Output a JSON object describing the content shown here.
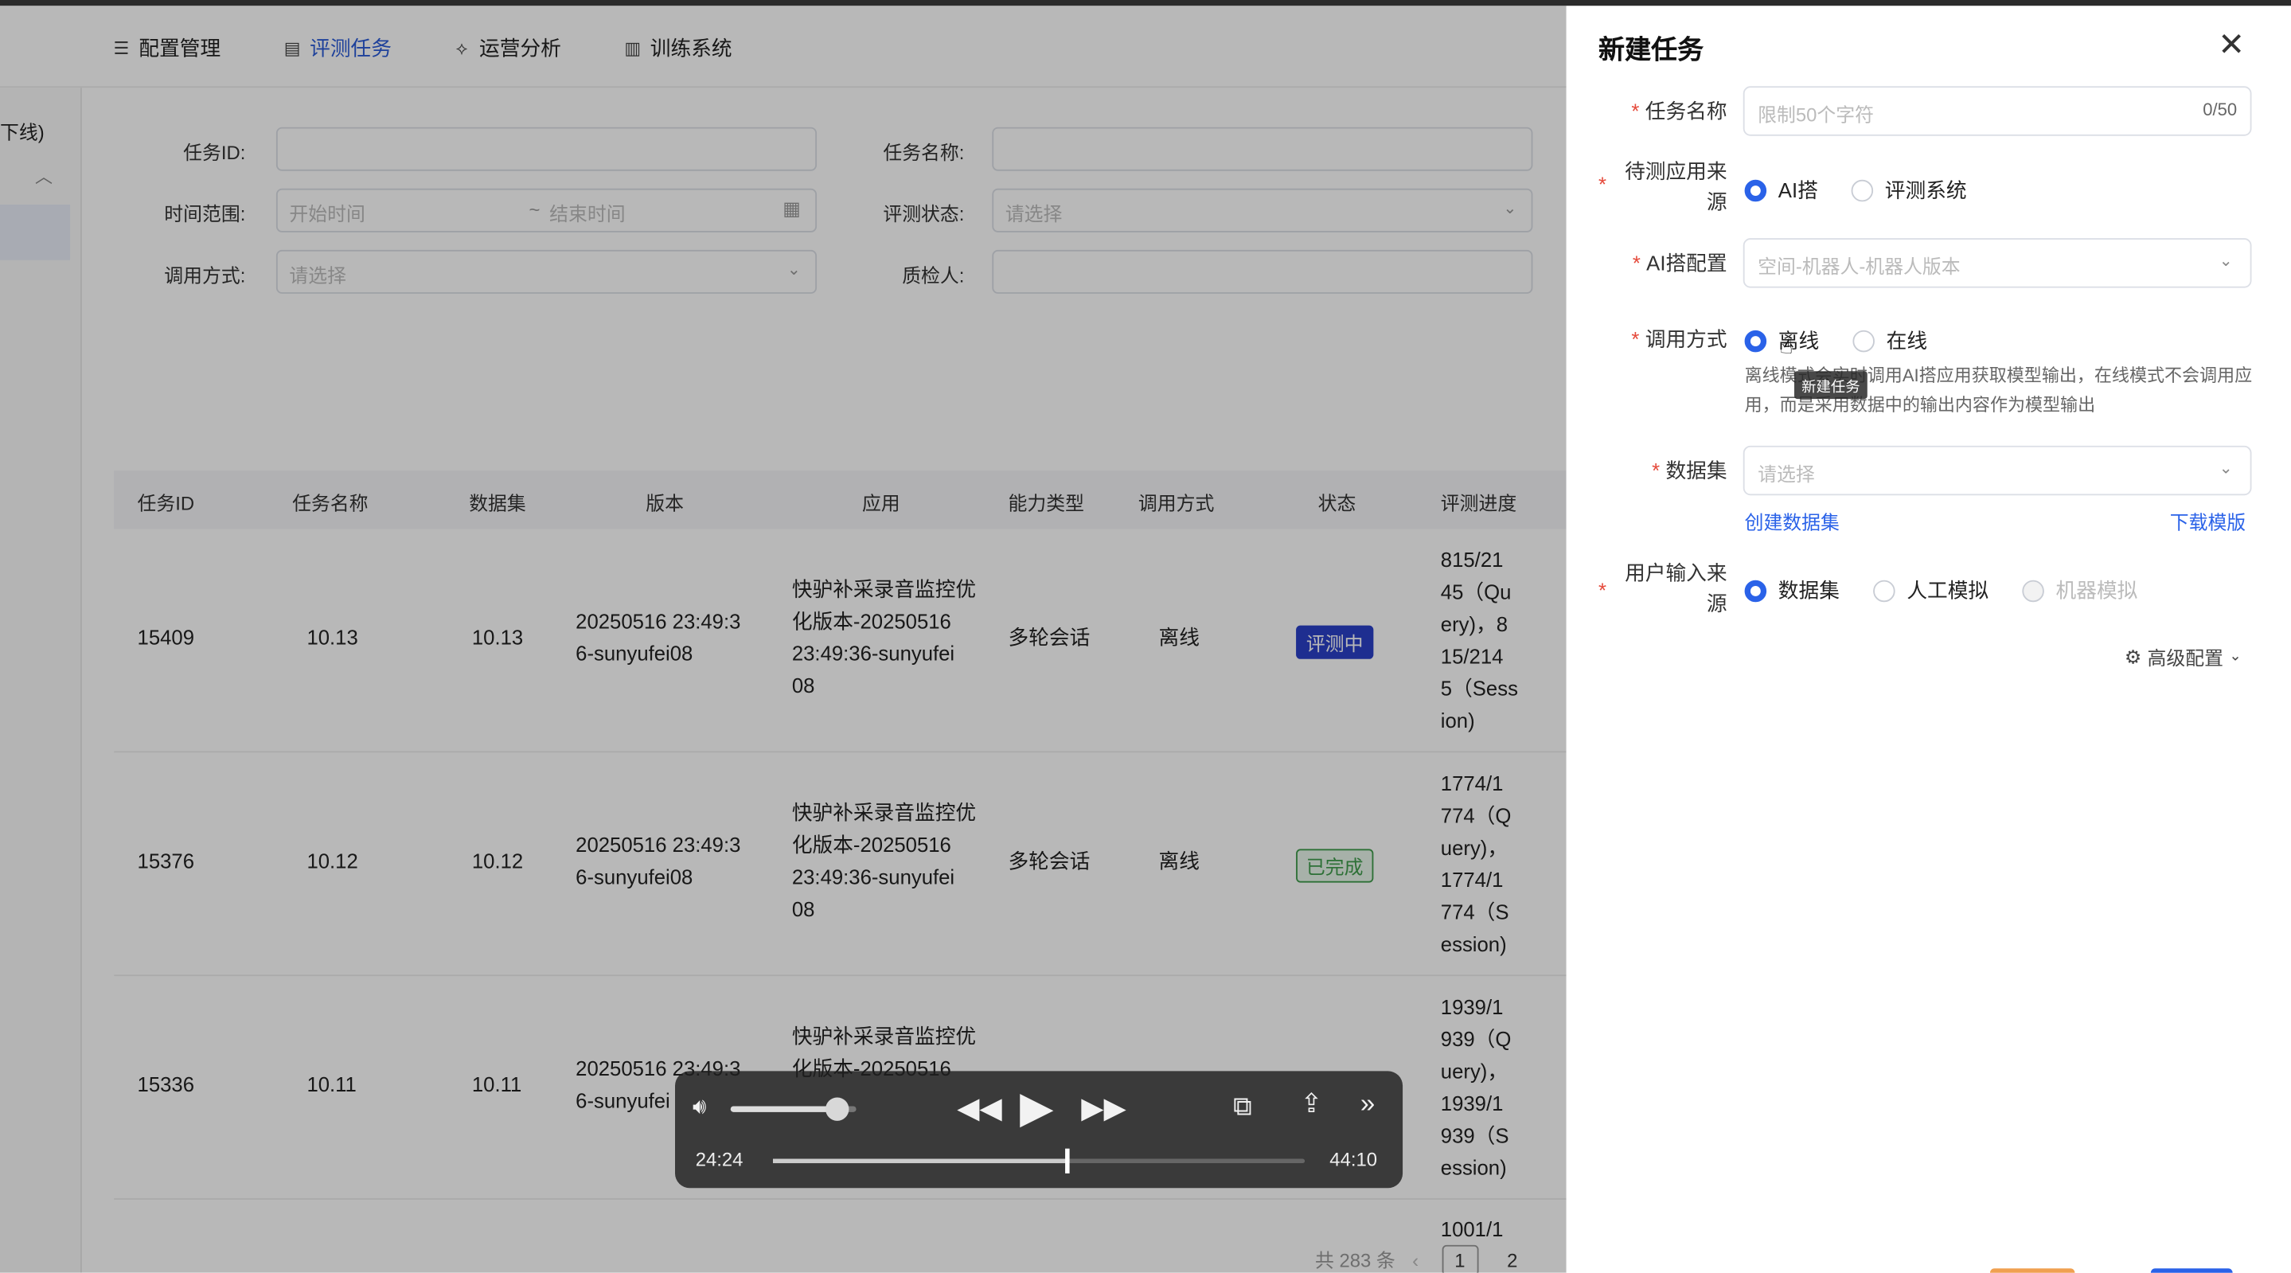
{
  "nav": {
    "items": [
      {
        "label": "配置管理",
        "icon": "sliders-icon"
      },
      {
        "label": "评测任务",
        "icon": "document-icon"
      },
      {
        "label": "运营分析",
        "icon": "analysis-icon"
      },
      {
        "label": "训练系统",
        "icon": "bar-chart-icon"
      }
    ]
  },
  "sidebar": {
    "partial_label": "下线)"
  },
  "filters": {
    "task_id_label": "任务ID:",
    "task_name_label": "任务名称:",
    "time_range_label": "时间范围:",
    "start_placeholder": "开始时间",
    "separator": "~",
    "end_placeholder": "结束时间",
    "eval_status_label": "评测状态:",
    "eval_status_placeholder": "请选择",
    "call_mode_label": "调用方式:",
    "call_mode_placeholder": "请选择",
    "inspector_label": "质检人:"
  },
  "table": {
    "headers": [
      "任务ID",
      "任务名称",
      "数据集",
      "版本",
      "应用",
      "能力类型",
      "调用方式",
      "状态",
      "评测进度"
    ],
    "rows": [
      {
        "id": "15409",
        "name": "10.13",
        "dataset": "10.13",
        "version": [
          "20250516 23:49:3",
          "6-sunyufei08"
        ],
        "app": [
          "快驴补采录音监控优",
          "化版本-20250516",
          "23:49:36-sunyufei",
          "08"
        ],
        "ability": "多轮会话",
        "mode": "离线",
        "status": "评测中",
        "progress": [
          "815/21",
          "45（Qu",
          "ery)，8",
          "15/214",
          "5（Sess",
          "ion)"
        ]
      },
      {
        "id": "15376",
        "name": "10.12",
        "dataset": "10.12",
        "version": [
          "20250516 23:49:3",
          "6-sunyufei08"
        ],
        "app": [
          "快驴补采录音监控优",
          "化版本-20250516",
          "23:49:36-sunyufei",
          "08"
        ],
        "ability": "多轮会话",
        "mode": "离线",
        "status": "已完成",
        "progress": [
          "1774/1",
          "774（Q",
          "uery)，",
          "1774/1",
          "774（S",
          "ession)"
        ]
      },
      {
        "id": "15336",
        "name": "10.11",
        "dataset": "10.11",
        "version": [
          "20250516 23:49:3",
          "6-sunyufei"
        ],
        "app": [
          "快驴补采录音监控优",
          "化版本-20250516"
        ],
        "ability": "",
        "mode": "",
        "status": "",
        "progress": [
          "1939/1",
          "939（Q",
          "uery)，",
          "1939/1",
          "939（S",
          "ession)"
        ]
      }
    ],
    "next_row_partial": "1001/1"
  },
  "pagination": {
    "total": "共 283 条",
    "page1": "1",
    "page2": "2"
  },
  "drawer": {
    "title": "新建任务",
    "fields": {
      "task_name_label": "任务名称",
      "task_name_placeholder": "限制50个字符",
      "task_name_count": "0/50",
      "app_source_label_1": "待测应用来",
      "app_source_label_2": "源",
      "app_source_options": [
        "AI搭",
        "评测系统"
      ],
      "ai_config_label": "AI搭配置",
      "ai_config_placeholder": "空间-机器人-机器人版本",
      "call_mode_label": "调用方式",
      "call_mode_options": [
        "离线",
        "在线"
      ],
      "call_mode_hint": "离线模式会实时调用AI搭应用获取模型输出，在线模式不会调用应用，而是采用数据中的输出内容作为模型输出",
      "tooltip": "新建任务",
      "dataset_label": "数据集",
      "dataset_placeholder": "请选择",
      "create_dataset_link": "创建数据集",
      "download_template_link": "下载模版",
      "user_input_label_1": "用户输入来",
      "user_input_label_2": "源",
      "user_input_options": [
        "数据集",
        "人工模拟",
        "机器模拟"
      ],
      "advanced_config": "高级配置"
    }
  },
  "player": {
    "elapsed": "24:24",
    "total": "44:10",
    "progress": 0.553,
    "volume": 0.85
  },
  "colors": {
    "accent": "#2a62e8",
    "status_running": "#2a40c8",
    "status_done": "#3f9b4c",
    "required": "#e5493a"
  }
}
